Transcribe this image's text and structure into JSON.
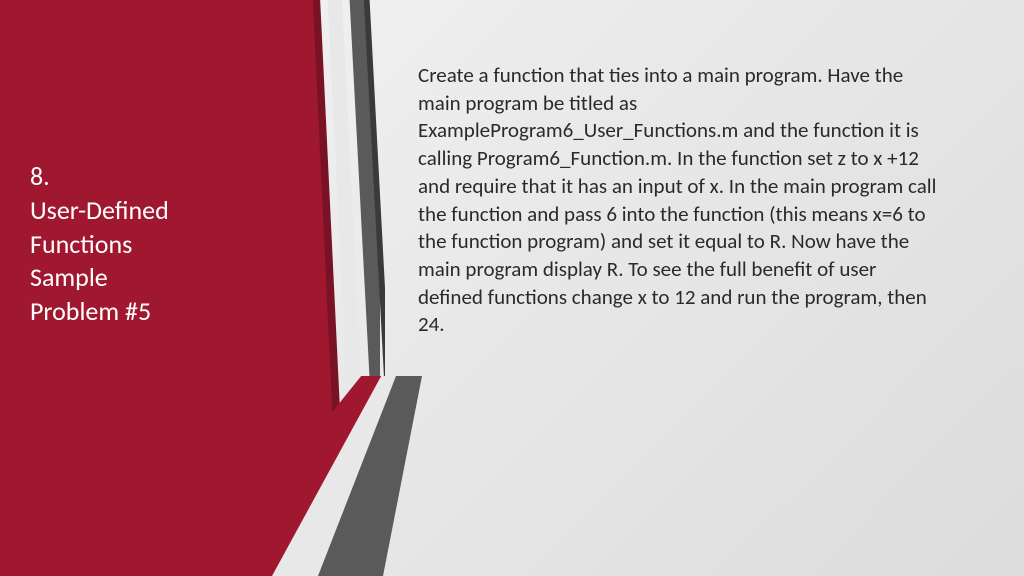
{
  "title": {
    "number": "8.",
    "line1": "User-Defined",
    "line2": "Functions",
    "line3": "Sample",
    "line4": "Problem #5"
  },
  "body_text": "Create  a function that ties into a main program. Have the main program be titled as ExampleProgram6_User_Functions.m and the function it is calling Program6_Function.m. In the function set z to x +12 and require that it has an input of x. In the main program call the function and pass 6 into the function (this means x=6 to the function program) and set it equal to R. Now have the main program display R. To see the full benefit of user defined functions change x to 12 and run the program, then 24."
}
